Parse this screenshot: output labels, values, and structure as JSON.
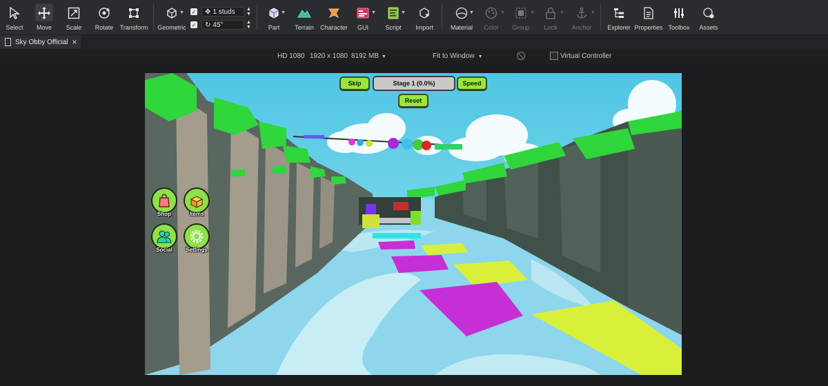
{
  "toolbar": {
    "tools": [
      {
        "label": "Select",
        "icon": "cursor-arrow-icon"
      },
      {
        "label": "Move",
        "icon": "move-arrows-icon"
      },
      {
        "label": "Scale",
        "icon": "scale-icon"
      },
      {
        "label": "Rotate",
        "icon": "rotate-icon"
      },
      {
        "label": "Transform",
        "icon": "transform-icon"
      }
    ],
    "geometric_label": "Geometric",
    "snap": {
      "move": "1 studs",
      "rotate": "45°"
    },
    "insert": [
      {
        "label": "Part",
        "icon": "part-cube-icon"
      },
      {
        "label": "Terrain",
        "icon": "terrain-icon"
      },
      {
        "label": "Character",
        "icon": "character-icon"
      },
      {
        "label": "GUI",
        "icon": "gui-icon"
      },
      {
        "label": "Script",
        "icon": "script-icon"
      },
      {
        "label": "Import",
        "icon": "import-icon"
      }
    ],
    "appearance": [
      {
        "label": "Material",
        "icon": "material-icon"
      },
      {
        "label": "Color",
        "icon": "color-palette-icon"
      },
      {
        "label": "Group",
        "icon": "group-icon"
      },
      {
        "label": "Lock",
        "icon": "lock-icon"
      },
      {
        "label": "Anchor",
        "icon": "anchor-icon"
      }
    ],
    "windows": [
      {
        "label": "Explorer",
        "icon": "explorer-icon"
      },
      {
        "label": "Properties",
        "icon": "properties-icon"
      },
      {
        "label": "Toolbox",
        "icon": "toolbox-icon"
      },
      {
        "label": "Assets",
        "icon": "assets-icon"
      }
    ]
  },
  "tab": {
    "title": "Sky Obby Official",
    "close": "×"
  },
  "viewbar": {
    "device": "HD 1080",
    "resolution": "1920 x 1080",
    "memory": "8192 MB",
    "fit": "Fit to Window",
    "virtual_controller": "Virtual Controller"
  },
  "game_hud": {
    "skip": "Skip",
    "stage": "Stage 1 (0.0%)",
    "speed": "Speed",
    "reset": "Reset",
    "side_buttons": [
      "Shop",
      "Items",
      "Social",
      "Settings"
    ]
  },
  "colors": {
    "toolbar_bg": "#2b2c2f",
    "accent_green": "#9be63e",
    "sky": "#4ec9e6",
    "platform_magenta": "#c62fd6",
    "platform_yellow": "#d9f03a"
  }
}
